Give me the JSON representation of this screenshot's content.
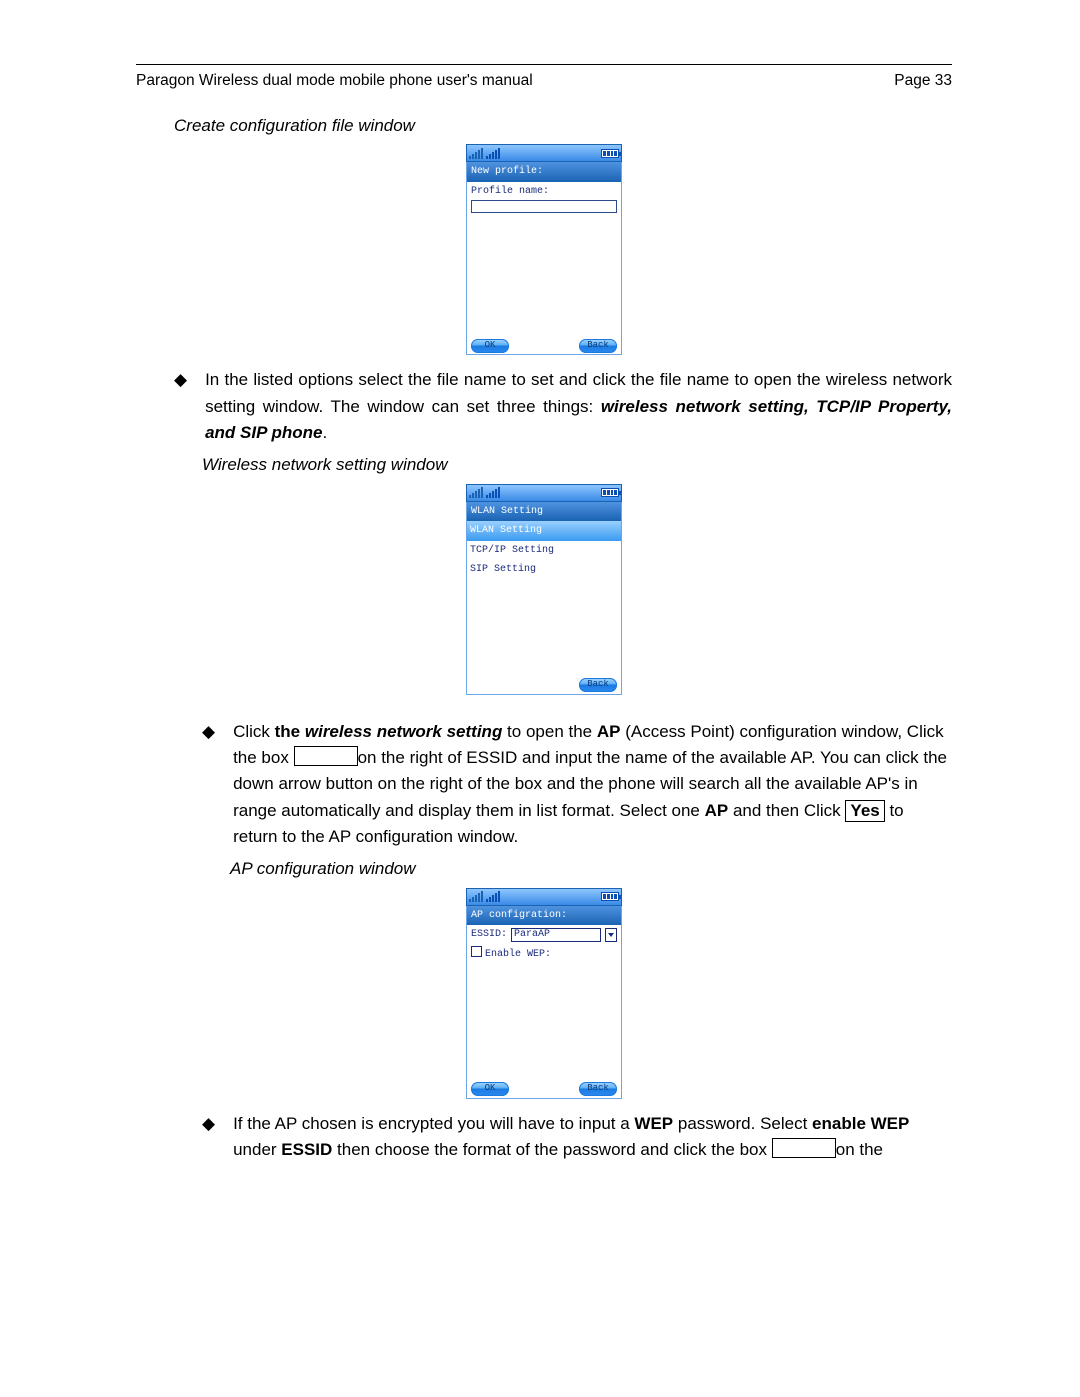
{
  "header": {
    "title": "Paragon Wireless dual mode mobile phone user's manual",
    "page": "Page 33"
  },
  "captions": {
    "create": "Create configuration file window",
    "wlan": "Wireless network setting window",
    "ap": "AP configuration window"
  },
  "screens": {
    "create": {
      "title": "New profile:",
      "label": "Profile name:",
      "softLeft": "OK",
      "softRight": "Back"
    },
    "wlan": {
      "title": "WLAN Setting",
      "items": [
        "WLAN Setting",
        "TCP/IP Setting",
        "SIP Setting"
      ],
      "softRight": "Back"
    },
    "ap": {
      "title": "AP configration:",
      "essidLabel": "ESSID:",
      "essidValue": "ParaAP",
      "enableWepLabel": "Enable WEP:",
      "softLeft": "OK",
      "softRight": "Back"
    }
  },
  "text": {
    "para1_a": "In  the  listed  options  select  the  file  name  to  set  and  click  the  file  name  to  open  the  wireless network setting window. The window can set three things: ",
    "para1_bolditalic": "wireless network setting, TCP/IP Property, and SIP phone",
    "para1_c": ".",
    "para2_a": "Click ",
    "para2_b": "the ",
    "para2_bolditalic": "wireless network setting",
    "para2_c": " to open the ",
    "para2_d": "AP",
    "para2_e": " (Access Point) configuration window, Click the box ",
    "para2_f": "on the right of ESSID and input the name of the available AP. You can click the down arrow button on the right of the box and the phone will search all the available AP's in range automatically and display them in list format. Select one ",
    "para2_g": "AP",
    "para2_h": " and then Click ",
    "para2_yes": "Yes",
    "para2_i": " to return to the AP configuration window.",
    "para3_a": "If the AP chosen is encrypted you will have to input a ",
    "para3_b": "WEP",
    "para3_c": " password. Select ",
    "para3_d": "enable WEP",
    "para3_e": " under ",
    "para3_f": "ESSID",
    "para3_g": " then choose the format of the password and click the box ",
    "para3_h": "on the"
  }
}
